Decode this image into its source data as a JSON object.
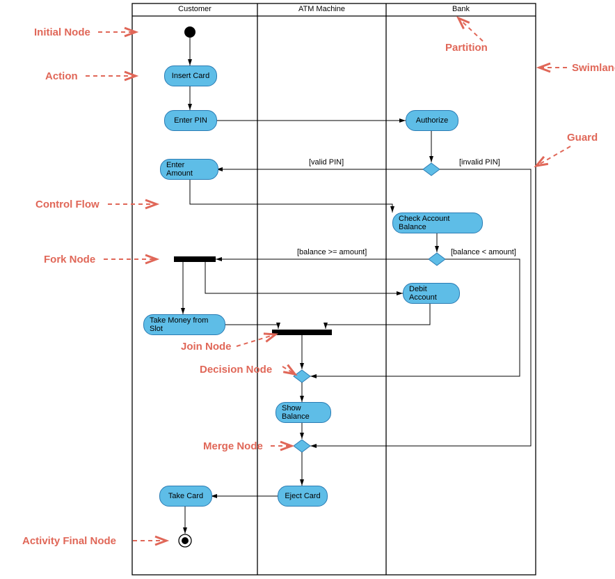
{
  "lanes": {
    "customer": "Customer",
    "atm": "ATM Machine",
    "bank": "Bank"
  },
  "actions": {
    "insertCard": "Insert Card",
    "enterPIN": "Enter PIN",
    "authorize": "Authorize",
    "enterAmount": "Enter Amount",
    "checkBalance": "Check Account Balance",
    "debitAccount": "Debit Account",
    "takeMoney": "Take Money from Slot",
    "showBalance": "Show Balance",
    "ejectCard": "Eject Card",
    "takeCard": "Take Card"
  },
  "guards": {
    "validPIN": "[valid PIN]",
    "invalidPIN": "[invalid PIN]",
    "balGE": "[balance >= amount]",
    "balLT": "[balance < amount]"
  },
  "annot": {
    "initial": "Initial Node",
    "action": "Action",
    "controlFlow": "Control Flow",
    "fork": "Fork Node",
    "activityFinal": "Activity Final Node",
    "partition": "Partition",
    "swimlane": "Swimlane",
    "guard": "Guard",
    "join": "Join Node",
    "decision": "Decision Node",
    "merge": "Merge Node"
  }
}
